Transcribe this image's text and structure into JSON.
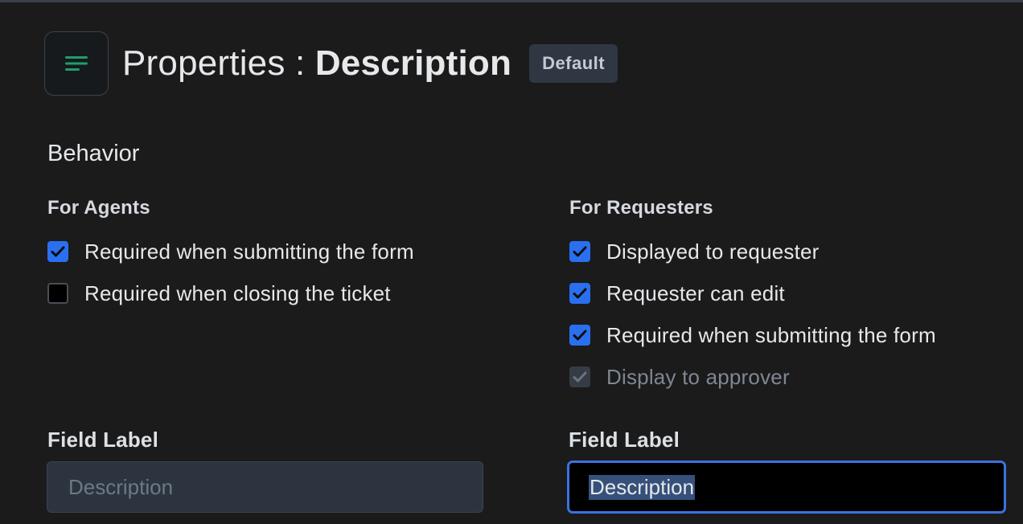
{
  "header": {
    "title_prefix": "Properties : ",
    "title_field": "Description",
    "badge": "Default",
    "icon": "align-left-lines-icon"
  },
  "behavior": {
    "section_title": "Behavior",
    "agents": {
      "title": "For Agents",
      "options": [
        {
          "label": "Required when submitting the form",
          "checked": true,
          "disabled": false
        },
        {
          "label": "Required when closing the ticket",
          "checked": false,
          "disabled": false
        }
      ]
    },
    "requesters": {
      "title": "For Requesters",
      "options": [
        {
          "label": "Displayed to requester",
          "checked": true,
          "disabled": false
        },
        {
          "label": "Requester can edit",
          "checked": true,
          "disabled": false
        },
        {
          "label": "Required when submitting the form",
          "checked": true,
          "disabled": false
        },
        {
          "label": "Display to approver",
          "checked": true,
          "disabled": true
        }
      ]
    }
  },
  "fields": {
    "agent_label_title": "Field Label",
    "agent_label_placeholder": "Description",
    "requester_label_title": "Field Label",
    "requester_label_value": "Description"
  },
  "colors": {
    "background": "#1b1b1b",
    "accent": "#2a6ff0",
    "icon_accent": "#1f9d6c",
    "badge_bg": "#2f3742"
  }
}
